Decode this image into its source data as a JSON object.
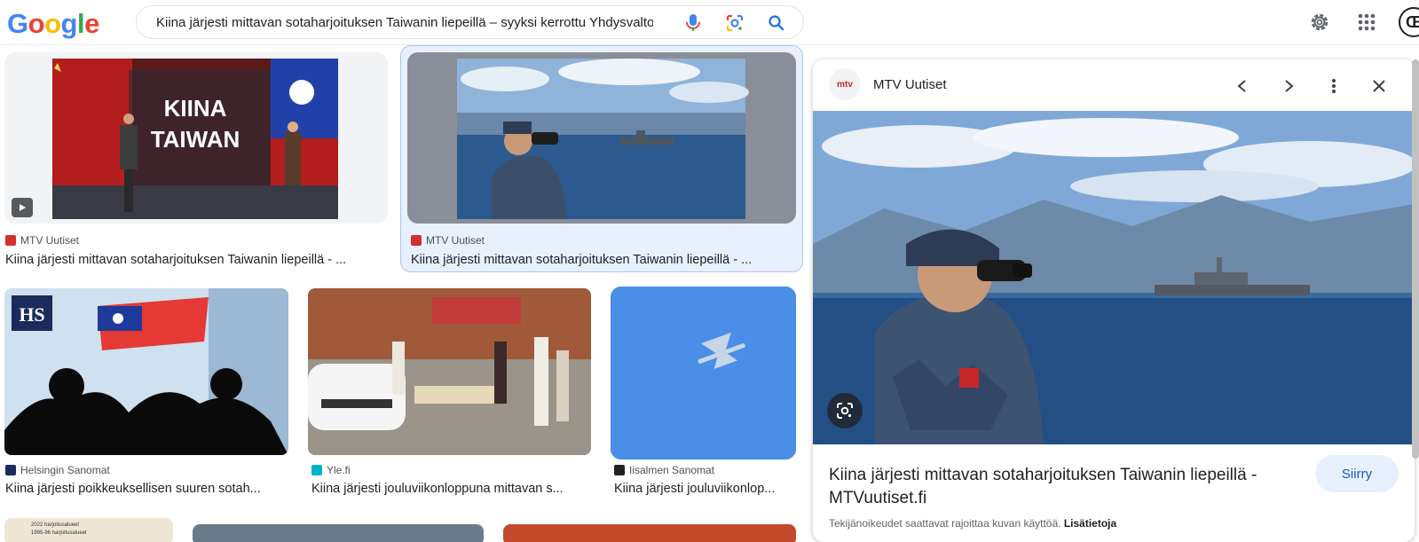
{
  "header": {
    "logo_letters": [
      "G",
      "o",
      "o",
      "g",
      "l",
      "e"
    ],
    "logo_colors": [
      "#4285F4",
      "#EA4335",
      "#FBBC05",
      "#4285F4",
      "#34A853",
      "#EA4335"
    ],
    "query": "Kiina järjesti mittavan sotaharjoituksen Taiwanin liepeillä – syyksi kerrottu Yhdysvaltoje",
    "icons": [
      "mic-icon",
      "lens-icon",
      "search-icon",
      "gear-icon",
      "apps-icon"
    ],
    "avatar_letter": "Œ"
  },
  "results": [
    {
      "source": "MTV Uutiset",
      "title": "Kiina järjesti mittavan sotaharjoituksen Taiwanin liepeillä - ...",
      "favicon_color": "#d32f2f",
      "thumb_text": [
        "KIINA",
        "TAIWAN"
      ],
      "has_video": true
    },
    {
      "source": "MTV Uutiset",
      "title": "Kiina järjesti mittavan sotaharjoituksen Taiwanin liepeillä - ...",
      "favicon_color": "#d32f2f",
      "selected": true
    },
    {
      "source": "Helsingin Sanomat",
      "title": "Kiina järjesti poikkeuksellisen suuren sotah...",
      "favicon_color": "#1a2b5c",
      "thumb_text": "HS"
    },
    {
      "source": "Yle.fi",
      "title": "Kiina järjesti jouluviikonloppuna mittavan s...",
      "favicon_color": "#00b4c8"
    },
    {
      "source": "Iisalmen Sanomat",
      "title": "Kiina järjesti jouluviikonlop...",
      "favicon_color": "#202124"
    }
  ],
  "bottom_row_partial": {
    "map_labels": [
      "2022 harjoitusalueet",
      "1995-96 harjoitusalueet"
    ]
  },
  "panel": {
    "source": "MTV Uutiset",
    "badge_text": "mtv",
    "title": "Kiina järjesti mittavan sotaharjoituksen Taiwanin liepeillä - MTVuutiset.fi",
    "visit_label": "Siirry",
    "copyright_text": "Tekijänoikeudet saattavat rajoittaa kuvan käyttöä.",
    "learn_more": "Lisätietoja",
    "icons": [
      "chevron-left-icon",
      "chevron-right-icon",
      "more-vert-icon",
      "close-icon",
      "lens-icon"
    ]
  }
}
